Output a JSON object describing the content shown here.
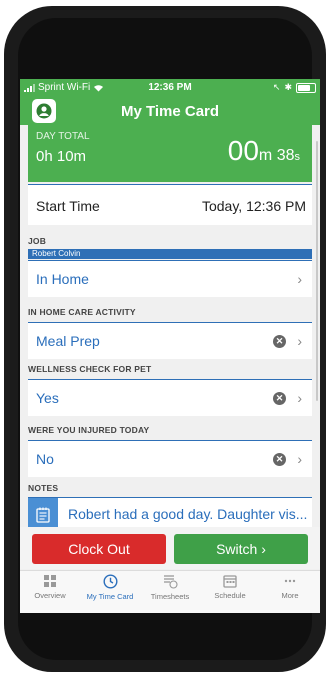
{
  "status_bar": {
    "carrier": "Sprint Wi-Fi",
    "time": "12:36 PM"
  },
  "nav": {
    "title": "My Time Card"
  },
  "day_total": {
    "label": "DAY TOTAL",
    "value": "0h 10m",
    "timer_minutes": "00",
    "timer_minutes_unit": "m",
    "timer_seconds": "38",
    "timer_seconds_unit": "s"
  },
  "start_time": {
    "label": "Start Time",
    "value": "Today, 12:36 PM"
  },
  "job": {
    "label": "JOB",
    "client": "Robert Colvin",
    "value": "In Home"
  },
  "activity": {
    "label": "IN HOME CARE ACTIVITY",
    "value": "Meal Prep"
  },
  "wellness": {
    "label": "WELLNESS CHECK FOR PET",
    "value": "Yes"
  },
  "injured": {
    "label": "WERE YOU INJURED TODAY",
    "value": "No"
  },
  "notes": {
    "label": "NOTES",
    "value": "Robert had a good day. Daughter vis..."
  },
  "actions": {
    "clock_out": "Clock Out",
    "switch": "Switch ›"
  },
  "tabs": [
    {
      "label": "Overview",
      "icon": "overview-icon"
    },
    {
      "label": "My Time Card",
      "icon": "clock-icon"
    },
    {
      "label": "Timesheets",
      "icon": "timesheets-icon"
    },
    {
      "label": "Schedule",
      "icon": "calendar-icon"
    },
    {
      "label": "More",
      "icon": "more-icon"
    }
  ],
  "colors": {
    "brand_green": "#4caf50",
    "accent_blue": "#2a6ebb",
    "clock_out_red": "#d92b2b"
  }
}
